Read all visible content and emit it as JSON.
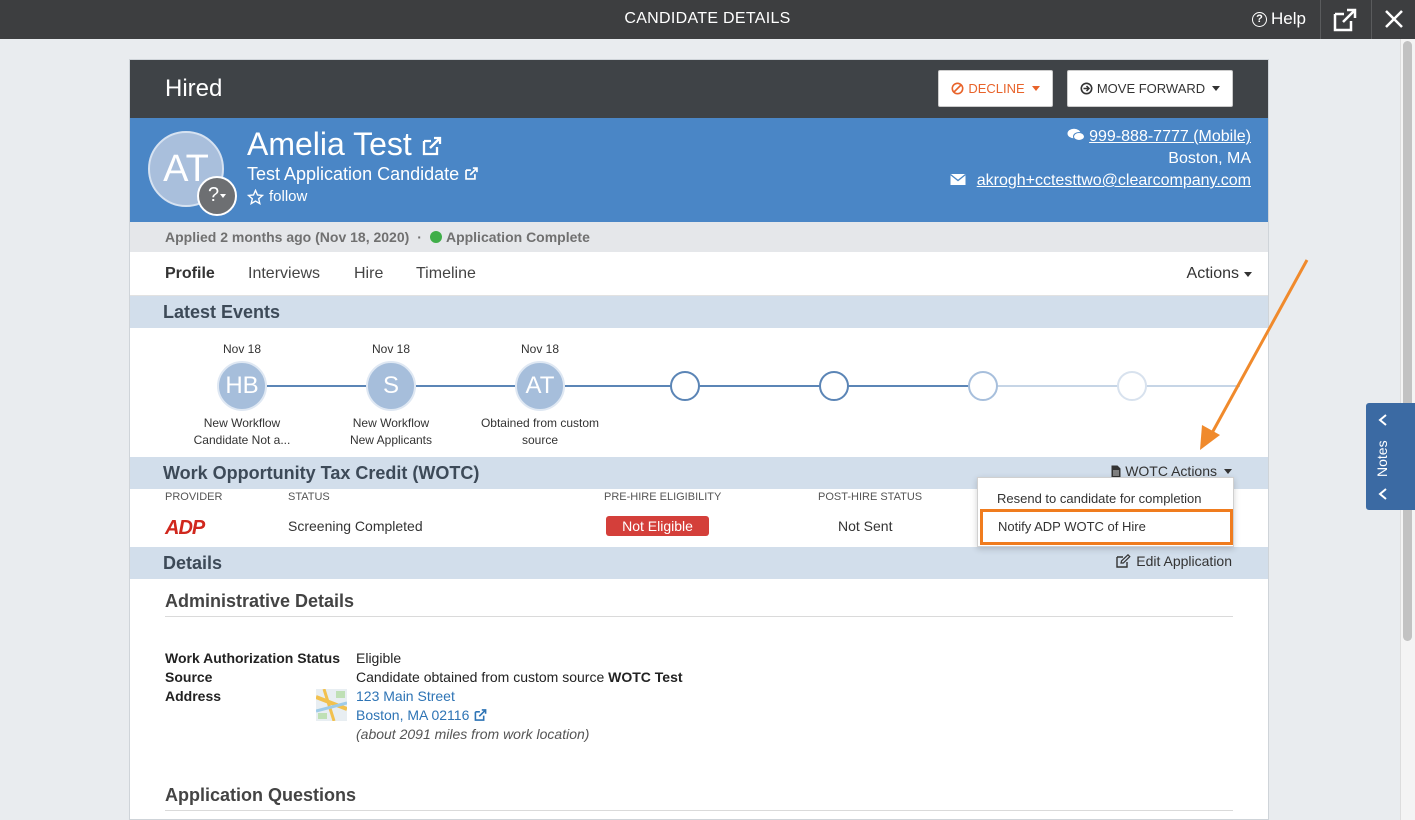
{
  "topbar": {
    "title": "CANDIDATE DETAILS",
    "help": "Help"
  },
  "stage": {
    "name": "Hired",
    "decline_label": "DECLINE",
    "forward_label": "MOVE FORWARD"
  },
  "candidate": {
    "initials": "AT",
    "badge": "?",
    "name": "Amelia Test",
    "job": "Test Application Candidate",
    "follow": "follow",
    "phone": "999-888-7777 (Mobile)",
    "location": "Boston, MA",
    "email": "akrogh+cctesttwo@clearcompany.com"
  },
  "applied": {
    "text": "Applied 2 months ago (Nov 18, 2020)",
    "separator": "·",
    "status": "Application Complete"
  },
  "tabs": [
    "Profile",
    "Interviews",
    "Hire",
    "Timeline"
  ],
  "actions_label": "Actions",
  "latest_events": {
    "title": "Latest Events",
    "events": [
      {
        "date": "Nov 18",
        "initials": "HB",
        "caption_line1": "New Workflow",
        "caption_line2": "Candidate Not a..."
      },
      {
        "date": "Nov 18",
        "initials": "S",
        "caption_line1": "New Workflow",
        "caption_line2": "New Applicants"
      },
      {
        "date": "Nov 18",
        "initials": "AT",
        "caption_line1": "Obtained from custom",
        "caption_line2": "source"
      }
    ]
  },
  "wotc": {
    "title": "Work Opportunity Tax Credit (WOTC)",
    "actions_label": "WOTC Actions",
    "columns": {
      "provider": "PROVIDER",
      "status": "STATUS",
      "pre_hire": "PRE-HIRE ELIGIBILITY",
      "post_hire": "POST-HIRE STATUS"
    },
    "row": {
      "provider_logo": "ADP",
      "status": "Screening Completed",
      "pre_hire": "Not Eligible",
      "post_hire": "Not Sent"
    },
    "menu": [
      "Resend to candidate for completion",
      "Notify ADP WOTC of Hire"
    ]
  },
  "details": {
    "title": "Details",
    "edit_label": "Edit Application",
    "admin_title": "Administrative Details",
    "work_auth_label": "Work Authorization Status",
    "work_auth_value": "Eligible",
    "source_label": "Source",
    "source_value_prefix": "Candidate obtained from custom source",
    "source_value_bold": "WOTC Test",
    "address_label": "Address",
    "address_line1": "123 Main Street",
    "address_line2": "Boston, MA 02116",
    "address_distance": "(about 2091 miles from work location)",
    "questions_title": "Application Questions"
  },
  "notes_label": "Notes",
  "colors": {
    "accent_blue": "#4a86c6",
    "decline_orange": "#e8632a",
    "highlight_orange": "#f07c1e",
    "badge_red": "#d43f3a"
  }
}
